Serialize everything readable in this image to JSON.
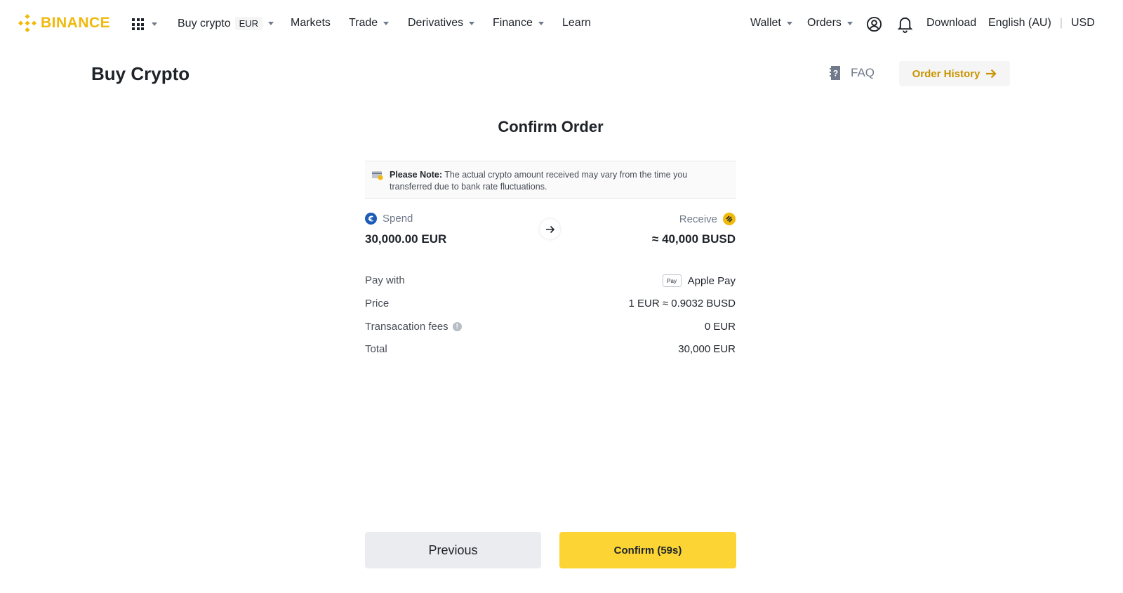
{
  "brand": {
    "name": "BINANCE",
    "color": "#F0B90B"
  },
  "nav": {
    "buy_crypto": "Buy crypto",
    "currency_badge": "EUR",
    "markets": "Markets",
    "trade": "Trade",
    "derivatives": "Derivatives",
    "finance": "Finance",
    "learn": "Learn",
    "wallet": "Wallet",
    "orders": "Orders",
    "download": "Download",
    "language": "English (AU)",
    "separator": "|",
    "display_currency": "USD"
  },
  "header": {
    "title": "Buy Crypto",
    "faq": "FAQ",
    "order_history": "Order History"
  },
  "confirm": {
    "title": "Confirm Order",
    "note_bold": "Please Note:",
    "note_text": " The actual crypto amount received may vary from the time you transferred due to bank rate fluctuations.",
    "spend_label": "Spend",
    "spend_value": "30,000.00 EUR",
    "receive_label": "Receive",
    "receive_value": "≈ 40,000 BUSD",
    "rows": [
      {
        "label": "Pay with",
        "value": "Apple Pay",
        "badge": "Pay"
      },
      {
        "label": "Price",
        "value": "1 EUR ≈ 0.9032 BUSD"
      },
      {
        "label": "Transacation fees",
        "value": "0 EUR"
      },
      {
        "label": "Total",
        "value": "30,000 EUR"
      }
    ],
    "previous_button": "Previous",
    "confirm_button": "Confirm (59s)"
  },
  "colors": {
    "accent": "#FCD535",
    "link": "#C99400",
    "eur_coin": "#1C5BB8",
    "busd_coin": "#F0B90B"
  }
}
